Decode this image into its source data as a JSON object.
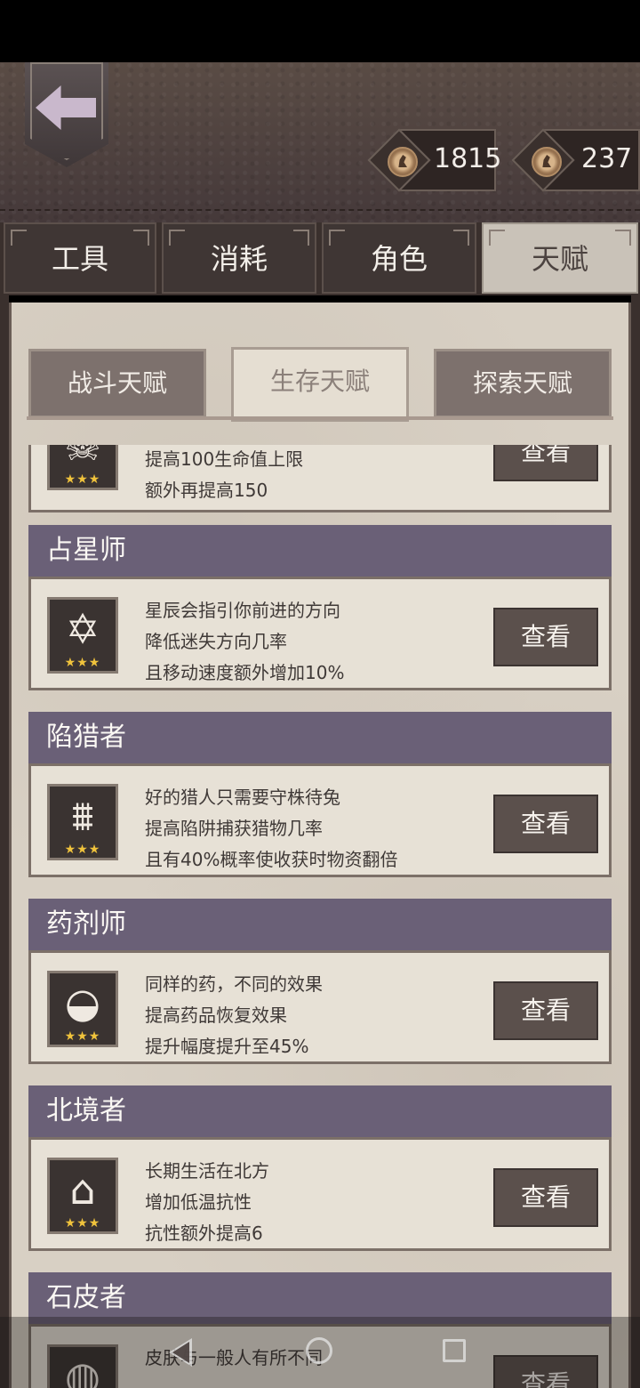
{
  "currencies": [
    {
      "icon": "coin-icon",
      "value": "1815"
    },
    {
      "icon": "coin-icon",
      "value": "237"
    }
  ],
  "main_tabs": [
    {
      "label": "工具",
      "active": false
    },
    {
      "label": "消耗",
      "active": false
    },
    {
      "label": "角色",
      "active": false
    },
    {
      "label": "天赋",
      "active": true
    }
  ],
  "sub_tabs": [
    {
      "label": "战斗天赋",
      "active": false
    },
    {
      "label": "生存天赋",
      "active": true
    },
    {
      "label": "探索天赋",
      "active": false
    }
  ],
  "view_label": "查看",
  "star_rating": "★★★",
  "partial_top": {
    "icon": "bull-skull-icon",
    "lines": [
      "提高100生命值上限",
      "额外再提高150"
    ]
  },
  "talents": [
    {
      "name": "占星师",
      "icon": "hexagram-icon",
      "lines": [
        "星辰会指引你前进的方向",
        "降低迷失方向几率",
        "且移动速度额外增加10%"
      ]
    },
    {
      "name": "陷猎者",
      "icon": "bear-trap-icon",
      "lines": [
        "好的猎人只需要守株待兔",
        "提高陷阱捕获猎物几率",
        "且有40%概率使收获时物资翻倍"
      ]
    },
    {
      "name": "药剂师",
      "icon": "mortar-pestle-icon",
      "lines": [
        "同样的药，不同的效果",
        "提高药品恢复效果",
        "提升幅度提升至45%"
      ]
    },
    {
      "name": "北境者",
      "icon": "igloo-icon",
      "lines": [
        "长期生活在北方",
        "增加低温抗性",
        "抗性额外提高6"
      ]
    },
    {
      "name": "石皮者",
      "icon": "stone-skin-icon",
      "lines": [
        "皮肤与一般人有所不同"
      ]
    }
  ]
}
